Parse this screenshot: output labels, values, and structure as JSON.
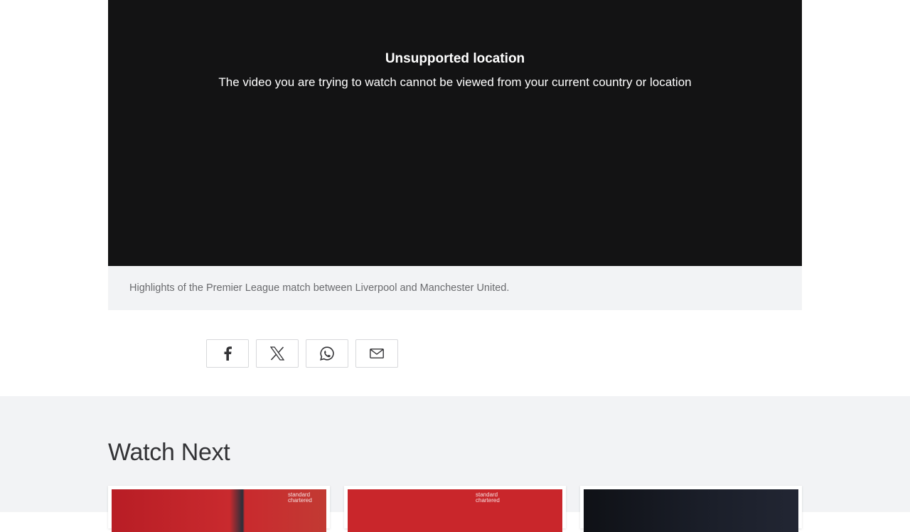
{
  "video": {
    "title": "Unsupported location",
    "message": "The video you are trying to watch cannot be viewed from your current country or location",
    "caption": "Highlights of the Premier League match between Liverpool and Manchester United."
  },
  "share": {
    "buttons": [
      {
        "icon": "facebook-icon"
      },
      {
        "icon": "x-icon"
      },
      {
        "icon": "whatsapp-icon"
      },
      {
        "icon": "email-icon"
      }
    ]
  },
  "watch_next": {
    "heading": "Watch Next",
    "cards": [
      {
        "thumb_sponsor": "standard chartered"
      },
      {
        "thumb_sponsor": "standard chartered"
      },
      {
        "thumb_sponsor": ""
      }
    ]
  },
  "colors": {
    "player_bg": "#131314",
    "caption_bg": "#f2f3f5",
    "section_bg": "#f2f3f5",
    "text_dark": "#333336",
    "text_muted": "#6a6b6e"
  }
}
